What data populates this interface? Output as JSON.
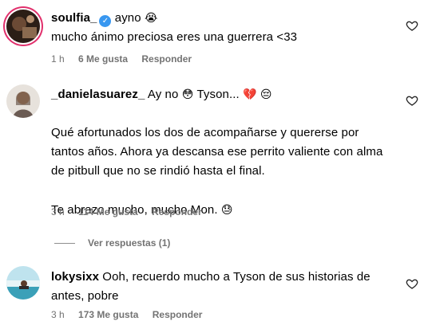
{
  "comments": [
    {
      "username": "soulfia_",
      "verified": true,
      "first_line": "ayno",
      "first_emoji": "😭",
      "text_lines": [
        "mucho ánimo preciosa eres una guerrera <33"
      ],
      "time": "1 h",
      "likes": "6 Me gusta",
      "reply": "Responder"
    },
    {
      "username": "_danielasuarez_",
      "first_line": "Ay no",
      "emoji_a": "😳",
      "mid_text": "Tyson...",
      "emoji_b": "💔",
      "emoji_c": "😔",
      "para1": [
        "Qué afortunados los dos de acompañarse y quererse por",
        "tantos años. Ahora ya descansa ese perrito valiente con alma",
        "de pitbull que no se rindió hasta el final."
      ],
      "para2": "Te abrazo mucho, mucho Mon.",
      "para2_emoji": "😓",
      "time": "3 h",
      "likes": "114 Me gusta",
      "reply": "Responder",
      "view_replies": "Ver respuestas (1)"
    },
    {
      "username": "lokysixx",
      "text_lines": [
        "Ooh, recuerdo mucho a Tyson de sus historias de",
        "antes, pobre"
      ],
      "time": "3 h",
      "likes": "173 Me gusta",
      "reply": "Responder"
    }
  ]
}
